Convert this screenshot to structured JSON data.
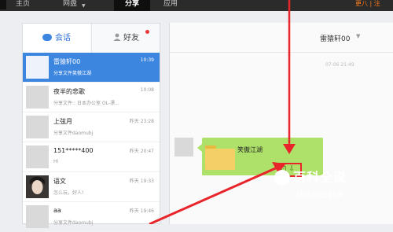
{
  "nav": {
    "items": [
      {
        "label": "主页"
      },
      {
        "label": "网盘"
      },
      {
        "label": "分享"
      },
      {
        "label": "应用"
      }
    ],
    "top_right": "更八 | 注"
  },
  "left_panel": {
    "tabs": {
      "sessions": "会话",
      "friends": "好友"
    },
    "conversations": [
      {
        "name": "雷猿轩00",
        "preview": "分享文件笑傲江湖",
        "time": "10:39",
        "selected": true
      },
      {
        "name": "夜半的悲歌",
        "preview": "分享文件:: 日本办公室 OL-漂...",
        "time": "10:08"
      },
      {
        "name": "上弦月",
        "preview": "分享文件daomubj",
        "time": "昨天 23:28"
      },
      {
        "name": "151*****400",
        "preview": "Hi",
        "time": "昨天 20:47"
      },
      {
        "name": "语文",
        "preview": "怎么玩，好人!",
        "time": "昨天 19:33"
      },
      {
        "name": "aa",
        "preview": "分享文件daomubj",
        "time": "昨天 19:46"
      }
    ]
  },
  "right_panel": {
    "contact_name": "雷猿轩00",
    "timestamp": "07-06 21:49",
    "message": {
      "file_name": "笑傲江湖"
    }
  },
  "watermark": {
    "title": "百科全说",
    "subtitle": "助你轻松解决"
  },
  "colors": {
    "accent": "#3d86e0",
    "bubble": "#aee16a",
    "highlight": "#e8252b"
  }
}
